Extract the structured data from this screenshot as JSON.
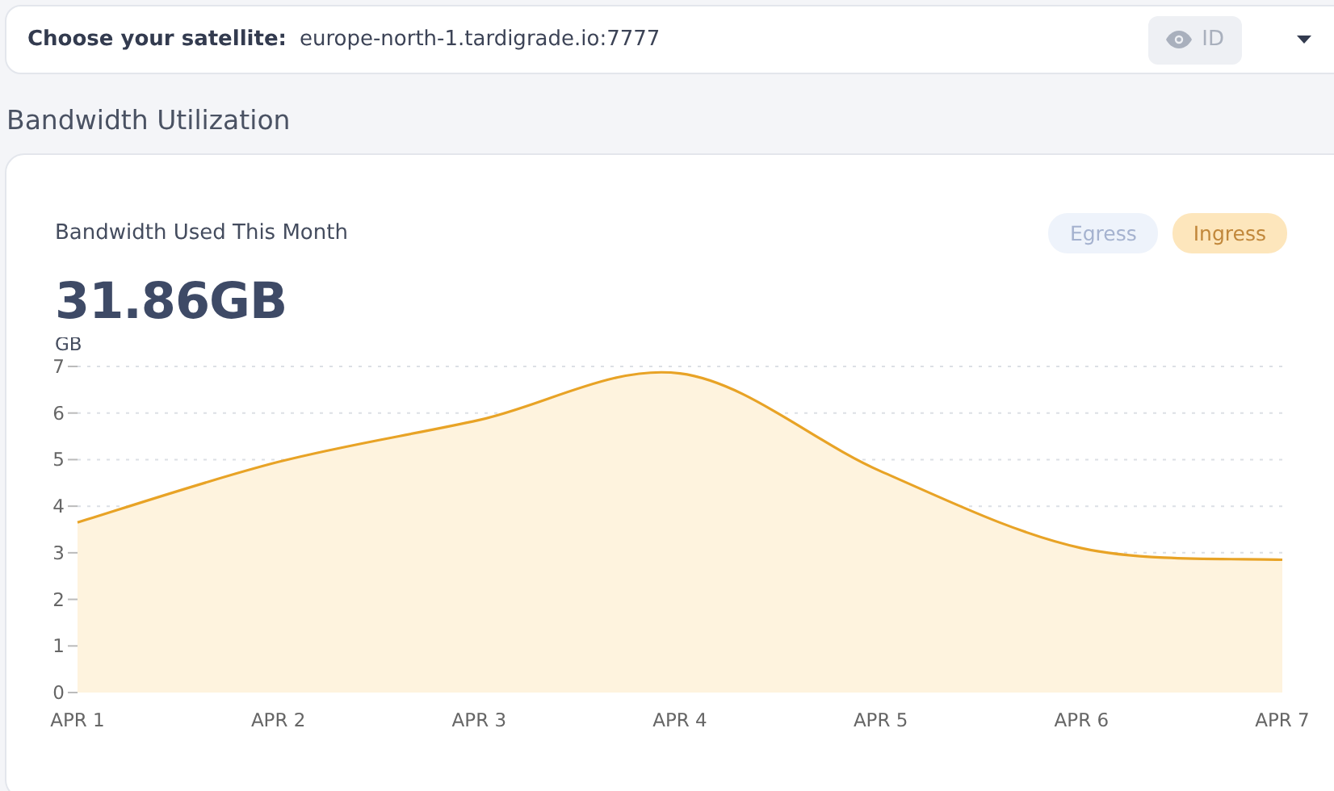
{
  "satellite_bar": {
    "label": "Choose your satellite:",
    "value": "europe-north-1.tardigrade.io:7777",
    "id_button": "ID"
  },
  "section_title": "Bandwidth Utilization",
  "card": {
    "title": "Bandwidth Used This Month",
    "total": "31.86GB",
    "toggles": [
      {
        "label": "Egress",
        "selected": false
      },
      {
        "label": "Ingress",
        "selected": true
      }
    ],
    "chart_data": {
      "type": "area",
      "ylabel": "GB",
      "categories": [
        "APR 1",
        "APR 2",
        "APR 3",
        "APR 4",
        "APR 5",
        "APR 6",
        "APR 7"
      ],
      "grid": true,
      "series": [
        {
          "color": "#e8a326",
          "values": [
            3.65,
            4.95,
            5.85,
            6.85,
            4.75,
            3.1,
            2.85
          ]
        }
      ],
      "ylim": [
        0,
        7
      ],
      "yticks": [
        0,
        1,
        2,
        3,
        4,
        5,
        6,
        7
      ]
    }
  }
}
